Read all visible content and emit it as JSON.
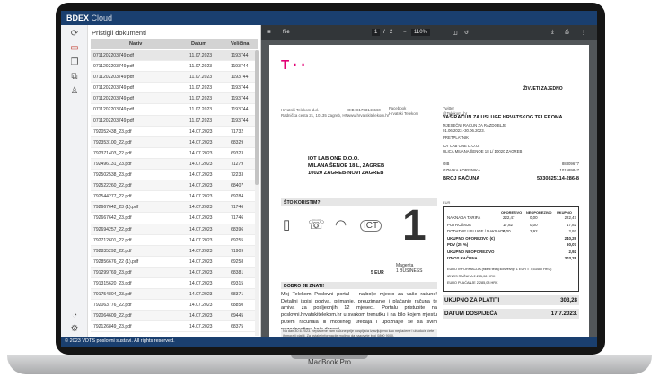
{
  "device": {
    "label": "MacBook Pro"
  },
  "app": {
    "brand": "BDEX",
    "brand_sub": "Cloud",
    "panel_title": "Pristigli dokumenti",
    "columns": {
      "name": "Naziv",
      "date": "Datum",
      "size": "Veličina"
    },
    "rows": [
      {
        "name": "0711202203749.pdf",
        "date": "11.07.2023",
        "size": "1193744"
      },
      {
        "name": "0711202203749.pdf",
        "date": "11.07.2023",
        "size": "1193744"
      },
      {
        "name": "0711202203749.pdf",
        "date": "11.07.2023",
        "size": "1193744"
      },
      {
        "name": "0711202203749.pdf",
        "date": "11.07.2023",
        "size": "1193744"
      },
      {
        "name": "0711202203749.pdf",
        "date": "11.07.2023",
        "size": "1193744"
      },
      {
        "name": "0711202203749.pdf",
        "date": "11.07.2023",
        "size": "1193744"
      },
      {
        "name": "0711202203749.pdf",
        "date": "11.07.2023",
        "size": "1193744"
      },
      {
        "name": "792052438_23.pdf",
        "date": "14.07.2023",
        "size": "71732"
      },
      {
        "name": "792353100_22.pdf",
        "date": "14.07.2023",
        "size": "68329"
      },
      {
        "name": "792371403_22.pdf",
        "date": "14.07.2023",
        "size": "69323"
      },
      {
        "name": "792496131_23.pdf",
        "date": "14.07.2023",
        "size": "71279"
      },
      {
        "name": "792502538_23.pdf",
        "date": "14.07.2023",
        "size": "72233"
      },
      {
        "name": "792522260_22.pdf",
        "date": "14.07.2023",
        "size": "68407"
      },
      {
        "name": "792544277_22.pdf",
        "date": "14.07.2023",
        "size": "69284"
      },
      {
        "name": "792667642_23 (1).pdf",
        "date": "14.07.2023",
        "size": "71746"
      },
      {
        "name": "792667642_23.pdf",
        "date": "14.07.2023",
        "size": "71746"
      },
      {
        "name": "792694257_22.pdf",
        "date": "14.07.2023",
        "size": "68396"
      },
      {
        "name": "792712601_22.pdf",
        "date": "14.07.2023",
        "size": "69255"
      },
      {
        "name": "792835292_22.pdf",
        "date": "14.07.2023",
        "size": "71909"
      },
      {
        "name": "792856676_22 (1).pdf",
        "date": "14.07.2023",
        "size": "69258"
      },
      {
        "name": "791299769_23.pdf",
        "date": "14.07.2023",
        "size": "68381"
      },
      {
        "name": "791315620_23.pdf",
        "date": "14.07.2023",
        "size": "69315"
      },
      {
        "name": "791754804_23.pdf",
        "date": "14.07.2023",
        "size": "68371"
      },
      {
        "name": "792063776_22.pdf",
        "date": "14.07.2023",
        "size": "68850"
      },
      {
        "name": "792064609_22.pdf",
        "date": "14.07.2023",
        "size": "69445"
      },
      {
        "name": "792126849_23.pdf",
        "date": "14.07.2023",
        "size": "68375"
      }
    ],
    "footer": "© 2023 VDTS poslovni sustavi. All rights reserved."
  },
  "pdf": {
    "file": "file",
    "page_current": "1",
    "page_sep": "/",
    "page_total": "2",
    "zoom": "110%",
    "logo": "T · ·",
    "company_line1": "Hrvatski Telekom d.d.",
    "company_line2": "Radnička cesta 21, 10135 Zagreb, HR",
    "oib_line": "OIB: 81793146560",
    "web_line": "www.hrvatskitelekom.hr",
    "fb_line": "Facebook",
    "fb_line2": "Hrvatski Telekom",
    "tw_line": "Twitter",
    "tw_line2": "@Telekom_hr",
    "live_text": "ŽIVJETI ZAJEDNO",
    "recipient_line1": "IOT LAB ONE D.O.O.",
    "recipient_line2": "MILANA ŠENOE 18 L, ZAGREB",
    "recipient_line3": "10020 ZAGREB-NOVI ZAGREB",
    "bill_heading": "VAŠ RAČUN ZA USLUGE HRVATSKOG TELEKOMA",
    "bill_period_label": "MJESEČNI RAČUN ZA RAZDOBLJE",
    "bill_period": "01.06.2023.-30.06.2023.",
    "payer_label": "PRETPLATNIK",
    "payer_name": "IOT LAB ONE D.O.O.",
    "payer_address": "ULICA MILANA ŠENOE 18 L/ 10020 ZAGREB",
    "oib_label": "OIB",
    "oib_value": "88309677",
    "client_label": "OZNAKA KORISNIKA",
    "client_value": "101589847",
    "bill_no_label": "BROJ RAČUNA",
    "bill_no": "5030825114-286-8",
    "section1": "ŠTO KORISTIM?",
    "price_label": "5 EUR",
    "magenta_label": "Magenta",
    "magenta_sub": "1 BUSINESS",
    "section2": "DOBRO JE ZNATI!",
    "para": "Moj Telekom Poslovni portal – najbolje mjesto za vaše račune! Detaljni ispisi poziva, primanje, preuzimanje i plaćanje računa te arhiva za posljednjih 12 mjeseci. Portalu pristupite na poslovni.hrvatskitelekom.hr u svakom trenutku i na bilo kojem mjestu putem računala ili mobilnog uređaja i upoznajte se sa svim pogodnostima koje donosi.",
    "note": "Na dan 30.6.2023. neplaćene vam račune prije dospijeća izjavljujemo kao neplaćene i ubuduće ćete ih morati platiti. Za ostale informacije molimo da nazovete broj 0800 9000.",
    "bill_lines": [
      {
        "label": "NAKNADA TARIFA",
        "v1": "222,47",
        "v2": "0,00",
        "total": "222,47"
      },
      {
        "label": "POTROŠNJA",
        "v1": "17,82",
        "v2": "0,00",
        "total": "17,82"
      },
      {
        "label": "DODATNE USLUGE / NAKNADE",
        "v1": "0,00",
        "v2": "2,92",
        "total": "2,92"
      },
      {
        "label": "UKUPNO OPOREZIVO (€)",
        "v1": "",
        "v2": "",
        "total": "240,29"
      },
      {
        "label": "PDV (25 %)",
        "v1": "",
        "v2": "",
        "total": "60,07"
      },
      {
        "label": "UKUPNO NEOPOREZIVO",
        "v1": "",
        "v2": "",
        "total": "2,92"
      },
      {
        "label": "IZNOS RAČUNA",
        "v1": "",
        "v2": "",
        "total": "303,28"
      }
    ],
    "bill_col1": "OPOREZIVO",
    "bill_col2": "NEOPOREZIVO",
    "bill_col3": "UKUPNO",
    "currency_label": "EUR",
    "fx_line": "EURO INFORMACIJA (fiksni tečaj konverzije 1 EUR = 7,53450 HRK)",
    "hrk_line1": "IZNOS RAČUNA 2.285,08 HRK",
    "hrk_line2": "EURO PLAĆANJE 2.285,08 HRK",
    "to_pay_label": "UKUPNO ZA PLATITI",
    "to_pay": "303,28",
    "due_label": "DATUM DOSPIJEĆA",
    "due": "17.7.2023."
  }
}
